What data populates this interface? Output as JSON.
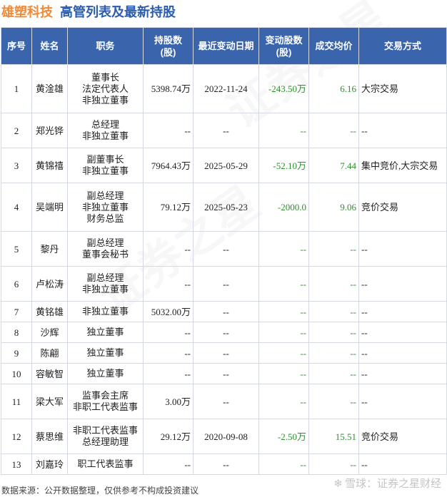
{
  "title": {
    "company": "雄塑科技",
    "subtitle": "高管列表及最新持股"
  },
  "table": {
    "headers": {
      "no": "序号",
      "name": "姓名",
      "position": "职务",
      "holding": "持股数\n(股)",
      "date": "最近变动日期",
      "change": "变动股数\n(股)",
      "price": "成交均价",
      "method": "交易方式"
    },
    "rows": [
      {
        "no": "1",
        "name": "黄淦雄",
        "positions": [
          "董事长",
          "法定代表人",
          "非独立董事"
        ],
        "holding": "5398.74万",
        "date": "2022-11-24",
        "change": "-243.50万",
        "price": "6.16",
        "method": "大宗交易"
      },
      {
        "no": "2",
        "name": "郑光铧",
        "positions": [
          "总经理",
          "非独立董事"
        ],
        "holding": "--",
        "date": "--",
        "change": "--",
        "price": "--",
        "method": "--"
      },
      {
        "no": "3",
        "name": "黄锦禧",
        "positions": [
          "副董事长",
          "非独立董事"
        ],
        "holding": "7964.43万",
        "date": "2025-05-29",
        "change": "-52.10万",
        "price": "7.44",
        "method": "集中竞价,大宗交易"
      },
      {
        "no": "4",
        "name": "吴端明",
        "positions": [
          "副总经理",
          "非独立董事",
          "财务总监"
        ],
        "holding": "79.12万",
        "date": "2025-05-23",
        "change": "-2000.0",
        "price": "9.06",
        "method": "竞价交易"
      },
      {
        "no": "5",
        "name": "黎丹",
        "positions": [
          "副总经理",
          "董事会秘书"
        ],
        "holding": "--",
        "date": "--",
        "change": "--",
        "price": "--",
        "method": "--"
      },
      {
        "no": "6",
        "name": "卢松涛",
        "positions": [
          "副总经理",
          "非独立董事"
        ],
        "holding": "--",
        "date": "--",
        "change": "--",
        "price": "--",
        "method": "--"
      },
      {
        "no": "7",
        "name": "黄铭雄",
        "positions": [
          "非独立董事"
        ],
        "holding": "5032.00万",
        "date": "--",
        "change": "--",
        "price": "--",
        "method": "--"
      },
      {
        "no": "8",
        "name": "沙辉",
        "positions": [
          "独立董事"
        ],
        "holding": "--",
        "date": "--",
        "change": "--",
        "price": "--",
        "method": "--"
      },
      {
        "no": "9",
        "name": "陈翩",
        "positions": [
          "独立董事"
        ],
        "holding": "--",
        "date": "--",
        "change": "--",
        "price": "--",
        "method": "--"
      },
      {
        "no": "10",
        "name": "容敏智",
        "positions": [
          "独立董事"
        ],
        "holding": "--",
        "date": "--",
        "change": "--",
        "price": "--",
        "method": "--"
      },
      {
        "no": "11",
        "name": "梁大军",
        "positions": [
          "监事会主席",
          "非职工代表监事"
        ],
        "holding": "3.00万",
        "date": "--",
        "change": "--",
        "price": "--",
        "method": "--"
      },
      {
        "no": "12",
        "name": "蔡思维",
        "positions": [
          "非职工代表监事",
          "总经理助理"
        ],
        "holding": "29.12万",
        "date": "2020-09-08",
        "change": "-2.50万",
        "price": "15.51",
        "method": "竞价交易"
      },
      {
        "no": "13",
        "name": "刘嘉玲",
        "positions": [
          "职工代表监事"
        ],
        "holding": "--",
        "date": "--",
        "change": "--",
        "price": "--",
        "method": "--"
      }
    ]
  },
  "footer": {
    "source": "数据来源：公开数据整理，仅供参考不构成投资建议"
  },
  "watermark": {
    "brand": "雪球：证券之星财经"
  }
}
